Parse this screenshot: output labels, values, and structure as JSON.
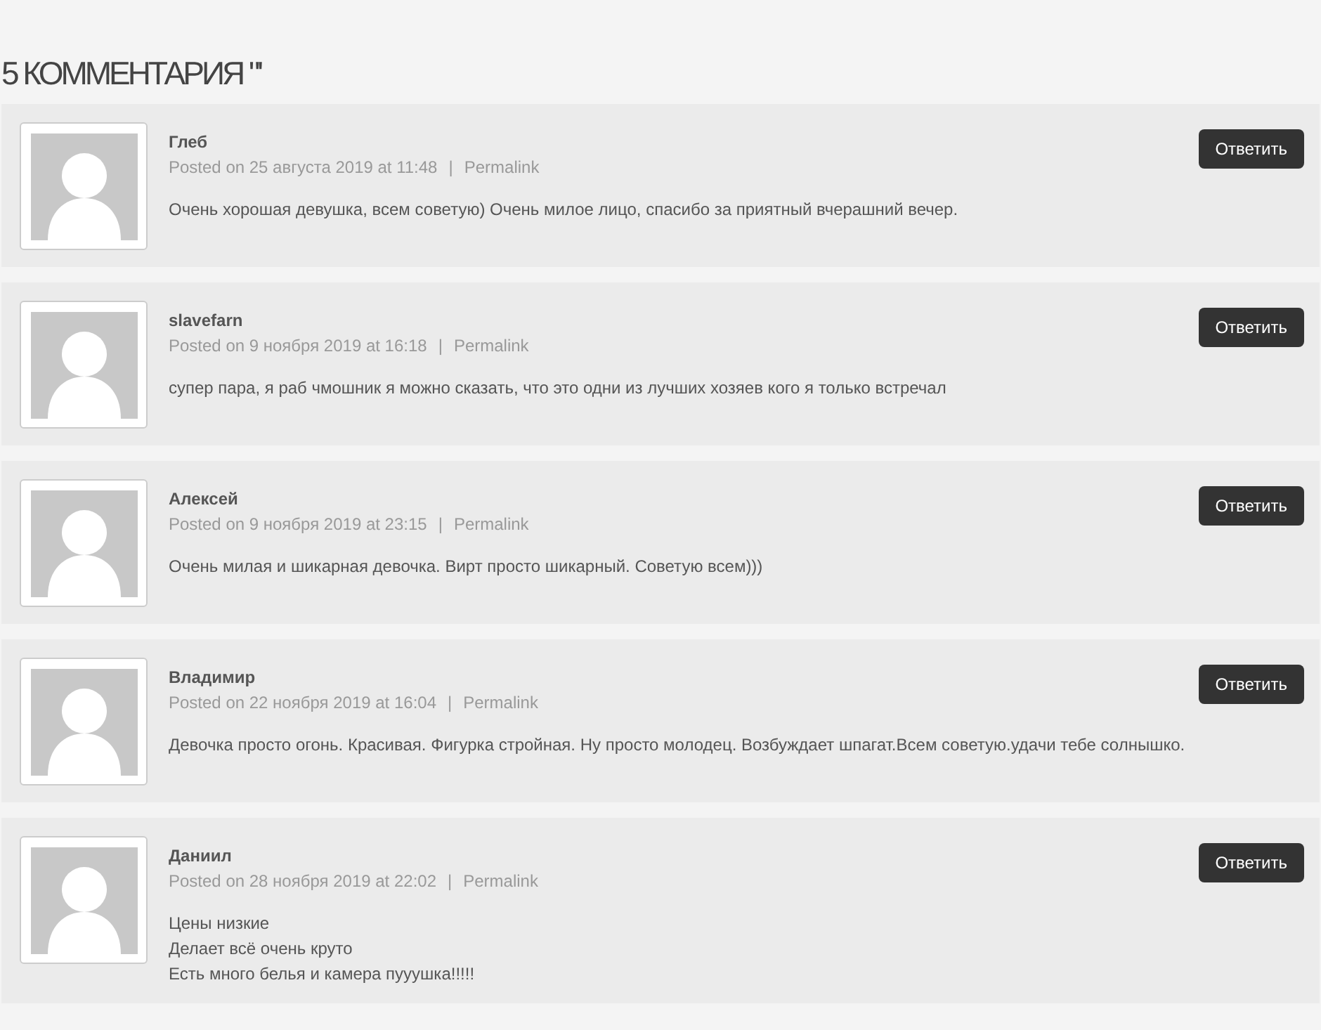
{
  "heading": "5 КОММЕНТАРИЯ \"'",
  "comments": [
    {
      "author": "Глеб",
      "posted": "Posted on 25 августа 2019 at 11:48",
      "separator": "|",
      "permalink": "Permalink",
      "text": "Очень хорошая девушка, всем советую) Очень милое лицо, спасибо за приятный вчерашний вечер.",
      "reply": "Ответить"
    },
    {
      "author": "slavefarn",
      "posted": "Posted on 9 ноября 2019 at 16:18",
      "separator": "|",
      "permalink": "Permalink",
      "text": "супер пара, я раб чмошник я можно сказать, что это одни из лучших хозяев кого я только встречал",
      "reply": "Ответить"
    },
    {
      "author": "Алексей",
      "posted": "Posted on 9 ноября 2019 at 23:15",
      "separator": "|",
      "permalink": "Permalink",
      "text": "Очень милая и шикарная девочка. Вирт просто шикарный. Советую всем)))",
      "reply": "Ответить"
    },
    {
      "author": "Владимир",
      "posted": "Posted on 22 ноября 2019 at 16:04",
      "separator": "|",
      "permalink": "Permalink",
      "text": "Девочка просто огонь. Красивая. Фигурка стройная. Ну просто молодец. Возбуждает шпагат.Всем советую.удачи тебе солнышко.",
      "reply": "Ответить"
    },
    {
      "author": "Даниил",
      "posted": "Posted on 28 ноября 2019 at 22:02",
      "separator": "|",
      "permalink": "Permalink",
      "text": "Цены низкие\nДелает всё очень круто\nЕсть много белья и камера пууушка!!!!!",
      "reply": "Ответить"
    }
  ]
}
